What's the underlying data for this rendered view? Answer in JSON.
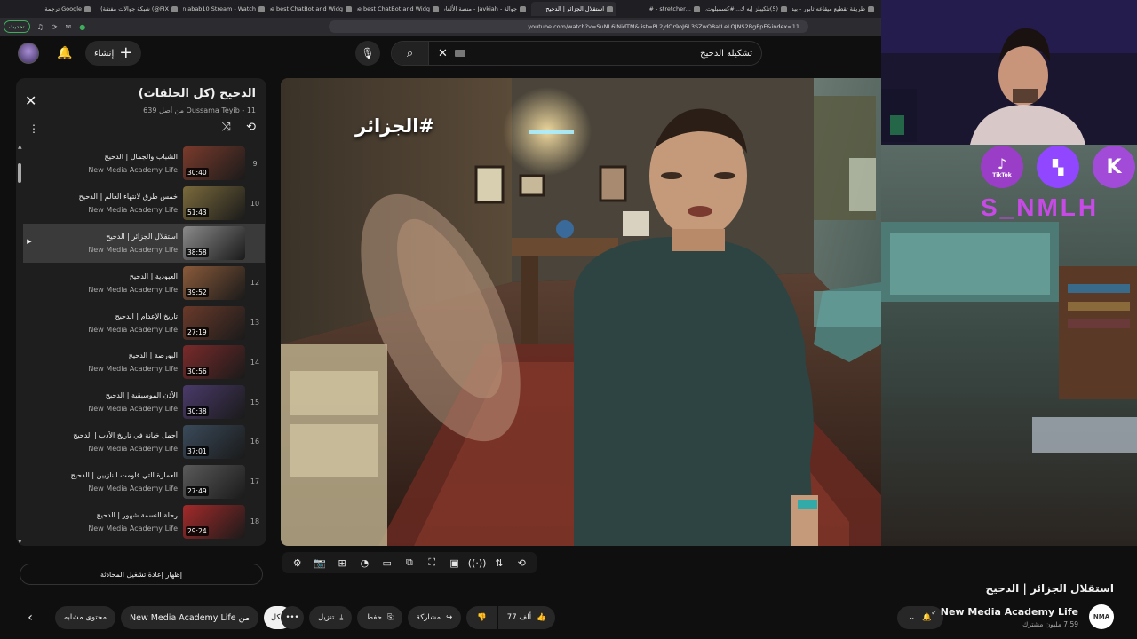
{
  "browser": {
    "tabs": [
      {
        "label": "طريقة تقطيع ميقاعه ثابور - بيد..."
      },
      {
        "label": "(5)تلكيبلز إيه ك...#كسمبلوت..."
      },
      {
        "label": "...stretcher - #"
      },
      {
        "label": "استقلال الجزائر | الدحيح"
      },
      {
        "label": "جوالة - Javkiah - منصة الألعاب..."
      },
      {
        "label": "The best ChatBot and Widg..."
      },
      {
        "label": "The best ChatBot and Widg..."
      },
      {
        "label": "aniabab10 Stream - Watch..."
      },
      {
        "label": "FIX@) شبكة جوالات مفتقة)"
      },
      {
        "label": "Google ترجمة"
      }
    ],
    "update_label": "تحديث",
    "url": "youtube.com/watch?v=SuNL6INidTM&list=PL2jdOr9oJ6L3SZwO8atLeLOJNS2BgPpE&index=11"
  },
  "header": {
    "create_label": "إنشاء",
    "search_value": "تشكيله الدحيح"
  },
  "playlist": {
    "title": "الدحيح (كل الحلقات)",
    "subtitle": "Oussama Teyib - 11 من أصل 639",
    "items": [
      {
        "num": "9",
        "title": "الشباب والجمال | الدحيح",
        "channel": "New Media Academy Life",
        "duration": "30:40",
        "active": false,
        "thumb": "#7a3b2c"
      },
      {
        "num": "10",
        "title": "خمس طرق لانتهاء العالم | الدحيح",
        "channel": "New Media Academy Life",
        "duration": "51:43",
        "active": false,
        "thumb": "#7a6a3c"
      },
      {
        "num": "",
        "title": "استقلال الجزائر | الدحيح",
        "channel": "New Media Academy Life",
        "duration": "38:58",
        "active": true,
        "thumb": "#8a8a8a"
      },
      {
        "num": "12",
        "title": "العبودية | الدحيح",
        "channel": "New Media Academy Life",
        "duration": "39:52",
        "active": false,
        "thumb": "#8a5a3a"
      },
      {
        "num": "13",
        "title": "تاريخ الإعدام | الدحيح",
        "channel": "New Media Academy Life",
        "duration": "27:19",
        "active": false,
        "thumb": "#6a3a2a"
      },
      {
        "num": "14",
        "title": "البورصة | الدحيح",
        "channel": "New Media Academy Life",
        "duration": "30:56",
        "active": false,
        "thumb": "#7a2a2a"
      },
      {
        "num": "15",
        "title": "الأذن الموسيقية | الدحيح",
        "channel": "New Media Academy Life",
        "duration": "30:38",
        "active": false,
        "thumb": "#4a3a6a"
      },
      {
        "num": "16",
        "title": "أجمل خيانة في تاريخ الأدب | الدحيح",
        "channel": "New Media Academy Life",
        "duration": "37:01",
        "active": false,
        "thumb": "#3a4a5a"
      },
      {
        "num": "17",
        "title": "العمارة التي قاومت النازيين | الدحيح",
        "channel": "New Media Academy Life",
        "duration": "27:49",
        "active": false,
        "thumb": "#5a5a5a"
      },
      {
        "num": "18",
        "title": "رحلة النسمة شهور | الدحيح",
        "channel": "New Media Academy Life",
        "duration": "29:24",
        "active": false,
        "thumb": "#a42a2a"
      }
    ],
    "replay_label": "إظهار إعادة تشغيل المحادثة"
  },
  "video": {
    "overlay_hashtag": "#الجزائر",
    "title": "استقلال الجزائر | الدحيح",
    "brand_text": "S_NMLH",
    "tiktok_label": "TikTok"
  },
  "channel": {
    "name": "New Media Academy Life",
    "subs": "7.59 مليون مشترك",
    "avatar_text": "NMA"
  },
  "actions": {
    "likes": "77 ألف",
    "share": "مشاركة",
    "save": "حفظ",
    "download": "تنزيل",
    "more": "•••",
    "chip_all": "الكل",
    "chip_from": "New Media Academy Life من",
    "chip_related": "محتوى مشابه"
  }
}
